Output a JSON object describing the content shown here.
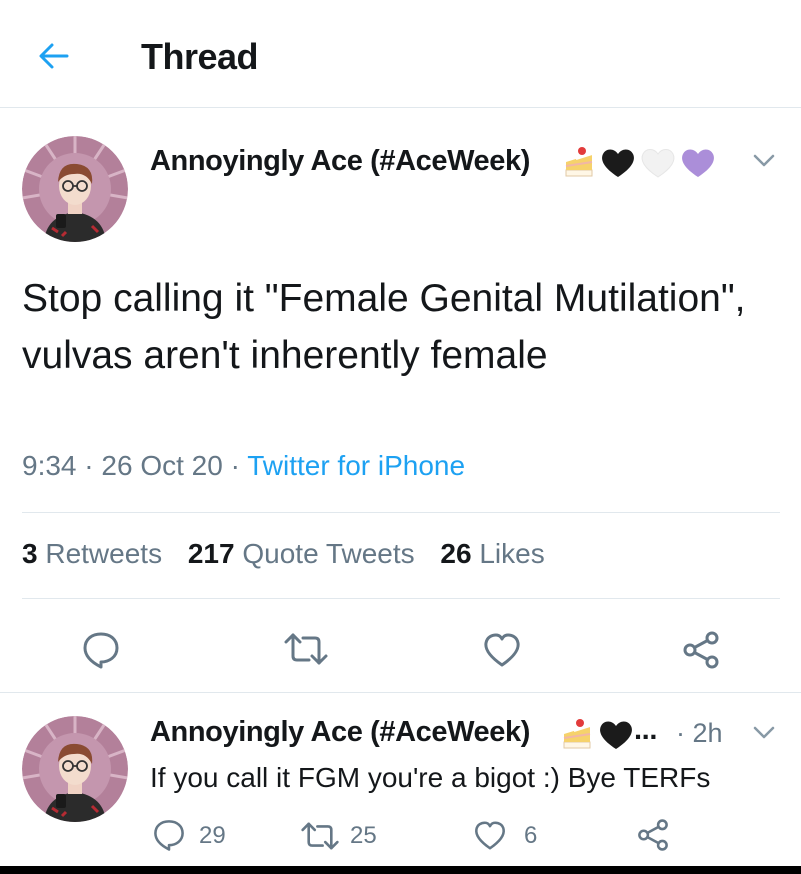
{
  "header": {
    "title": "Thread"
  },
  "main_tweet": {
    "author_name": "Annoyingly Ace (#AceWeek)",
    "text": "Stop calling it \"Female Genital Mutilation\", vulvas aren't inherently female",
    "time": "9:34",
    "date": "26 Oct 20",
    "source": "Twitter for iPhone",
    "separator": "·",
    "stats": {
      "retweets_count": "3",
      "retweets_label": "Retweets",
      "quote_count": "217",
      "quote_label": "Quote Tweets",
      "likes_count": "26",
      "likes_label": "Likes"
    }
  },
  "reply_tweet": {
    "author_name": "Annoyingly Ace (#AceWeek)",
    "ellipsis": "...",
    "time": "· 2h",
    "text": "If you call it FGM you're a bigot :) Bye TERFs",
    "reply_count": "29",
    "retweet_count": "25",
    "like_count": "6"
  },
  "colors": {
    "accent": "#1da1f2",
    "muted": "#657786",
    "text": "#14171a",
    "divider": "#e1e8ed"
  },
  "icons": [
    "back-arrow-icon",
    "chevron-down-icon",
    "reply-icon",
    "retweet-icon",
    "like-icon",
    "share-icon",
    "cake-emoji",
    "black-heart-emoji",
    "white-heart-emoji",
    "purple-heart-emoji"
  ]
}
